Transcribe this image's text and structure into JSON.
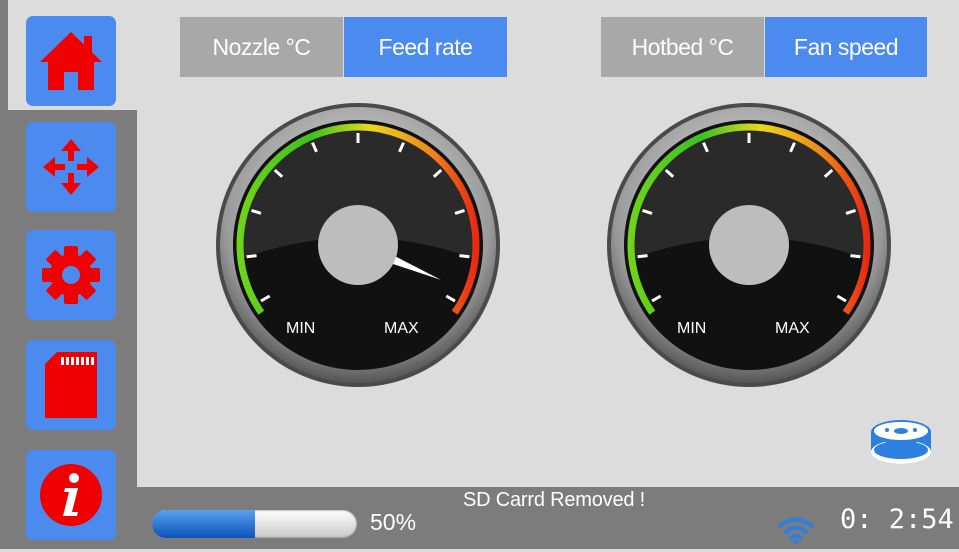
{
  "sidebar": {
    "items": [
      {
        "name": "home",
        "icon": "home-icon",
        "active": true
      },
      {
        "name": "move",
        "icon": "move-arrows-icon",
        "active": false
      },
      {
        "name": "settings",
        "icon": "gear-icon",
        "active": false
      },
      {
        "name": "sd-card",
        "icon": "sd-card-icon",
        "active": false
      },
      {
        "name": "info",
        "icon": "info-icon",
        "active": false
      }
    ]
  },
  "left_panel": {
    "tab_inactive": "Nozzle °C",
    "tab_active": "Feed rate",
    "gauge": {
      "min_label": "MIN",
      "max_label": "MAX",
      "needle_fraction": 0.97
    }
  },
  "right_panel": {
    "tab_inactive": "Hotbed °C",
    "tab_active": "Fan speed",
    "gauge": {
      "min_label": "MIN",
      "max_label": "MAX",
      "needle_fraction": null
    }
  },
  "status_bar": {
    "progress_percent": 50,
    "progress_text": "50%",
    "message": "SD  Carrd  Removed !",
    "clock": "0: 2:54",
    "wifi_icon": "wifi-icon"
  },
  "filament_icon": "filament-spool-icon",
  "colors": {
    "accent_blue": "#4b8bf0",
    "icon_red": "#f00000",
    "sidebar_gray": "#7c7c7c",
    "background": "#dcdcdc"
  }
}
